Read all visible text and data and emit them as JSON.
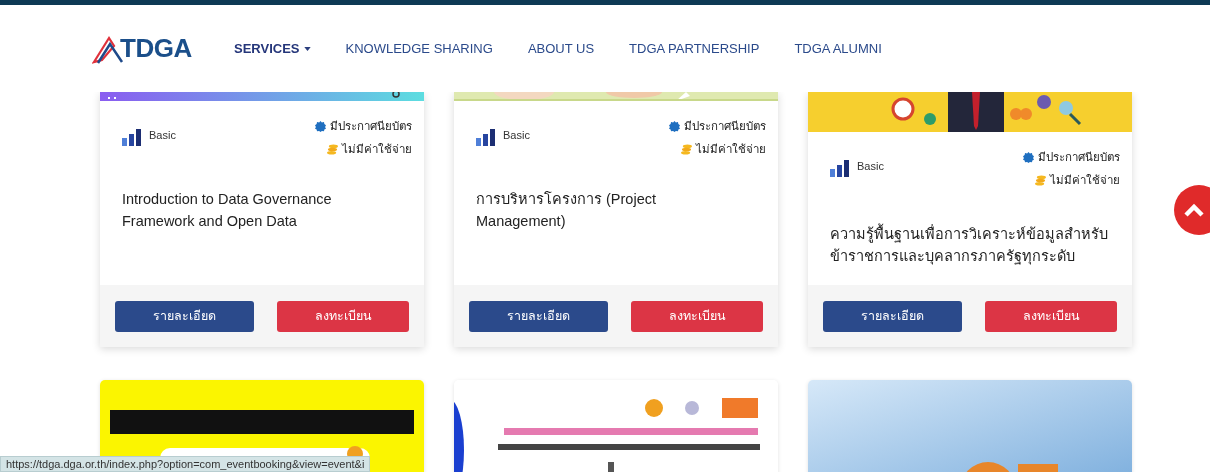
{
  "header": {
    "logo": "TDGA",
    "nav": [
      {
        "label": "SERVICES",
        "selected": true,
        "dropdown": true
      },
      {
        "label": "KNOWLEDGE SHARING",
        "selected": false,
        "dropdown": false
      },
      {
        "label": "ABOUT US",
        "selected": false,
        "dropdown": false
      },
      {
        "label": "TDGA PARTNERSHIP",
        "selected": false,
        "dropdown": false
      },
      {
        "label": "TDGA ALUMNI",
        "selected": false,
        "dropdown": false
      }
    ]
  },
  "courses": [
    {
      "cover": {
        "kind": "picture"
      },
      "level": "Basic",
      "certificate": "มีประกาศนียบัตร",
      "fee": "ไม่มีค่าใช้จ่าย",
      "title": "Introduction to Data Governance Framework and Open Data",
      "buttons": [
        "รายละเอียด",
        "ลงทะเบียน"
      ]
    },
    {
      "cover": {
        "kind": "picture"
      },
      "level": "Basic",
      "certificate": "มีประกาศนียบัตร",
      "fee": "ไม่มีค่าใช้จ่าย",
      "title": "การบริหารโครงการ (Project Management)",
      "buttons": [
        "รายละเอียด",
        "ลงทะเบียน"
      ]
    },
    {
      "cover": {
        "kind": "picture"
      },
      "level": "Basic",
      "certificate": "มีประกาศนียบัตร",
      "fee": "ไม่มีค่าใช้จ่าย",
      "title": "ความรู้พื้นฐานเพื่อการวิเคราะห์ข้อมูลสำหรับข้าราชการและบุคลากรภาครัฐทุกระดับ",
      "buttons": [
        "รายละเอียด",
        "ลงทะเบียน"
      ]
    }
  ],
  "more_courses": [
    {
      "cover": {
        "kind": "picture"
      }
    },
    {
      "cover": {
        "kind": "picture"
      }
    },
    {
      "cover": {
        "kind": "picture"
      }
    }
  ],
  "status_bar": {
    "url": "https://tdga.dga.or.th/index.php?option=com_eventbooking&view=event&i"
  }
}
